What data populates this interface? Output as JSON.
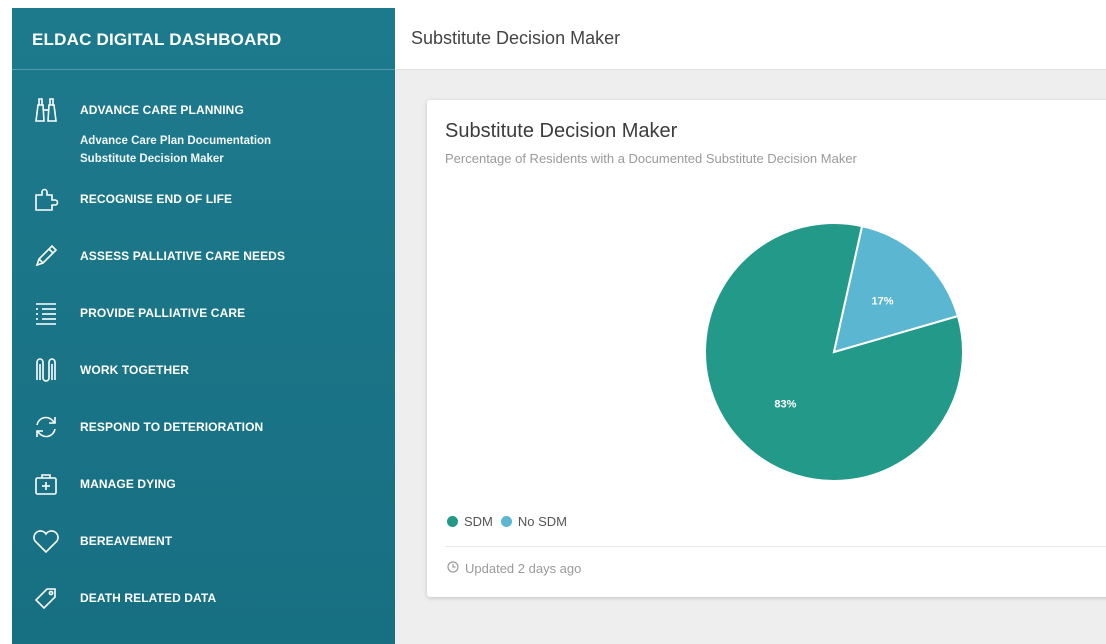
{
  "sidebar": {
    "brand": "ELDAC DIGITAL DASHBOARD",
    "items": [
      {
        "label": "ADVANCE CARE PLANNING",
        "icon": "binoculars-icon"
      },
      {
        "label": "RECOGNISE END OF LIFE",
        "icon": "puzzle-icon"
      },
      {
        "label": "ASSESS PALLIATIVE CARE NEEDS",
        "icon": "pencil-icon"
      },
      {
        "label": "PROVIDE PALLIATIVE CARE",
        "icon": "checklist-icon"
      },
      {
        "label": "WORK TOGETHER",
        "icon": "linked-shapes-icon"
      },
      {
        "label": "RESPOND TO DETERIORATION",
        "icon": "refresh-icon"
      },
      {
        "label": "MANAGE DYING",
        "icon": "medical-kit-icon"
      },
      {
        "label": "BEREAVEMENT",
        "icon": "heart-icon"
      },
      {
        "label": "DEATH RELATED DATA",
        "icon": "tag-icon"
      }
    ],
    "sub_items": [
      "Advance Care Plan Documentation",
      "Substitute Decision Maker"
    ]
  },
  "header": {
    "title": "Substitute Decision Maker"
  },
  "card": {
    "title": "Substitute Decision Maker",
    "subtitle": "Percentage of Residents with a Documented Substitute Decision Maker",
    "footer": "Updated 2 days ago"
  },
  "colors": {
    "sdm": "#23998a",
    "no_sdm": "#5bb6d1",
    "sidebar": "#1b7688"
  },
  "chart_data": {
    "type": "pie",
    "categories": [
      "SDM",
      "No SDM"
    ],
    "values": [
      83,
      17
    ],
    "data_labels": [
      "83%",
      "17%"
    ],
    "legend_placement": "bottom-left"
  }
}
